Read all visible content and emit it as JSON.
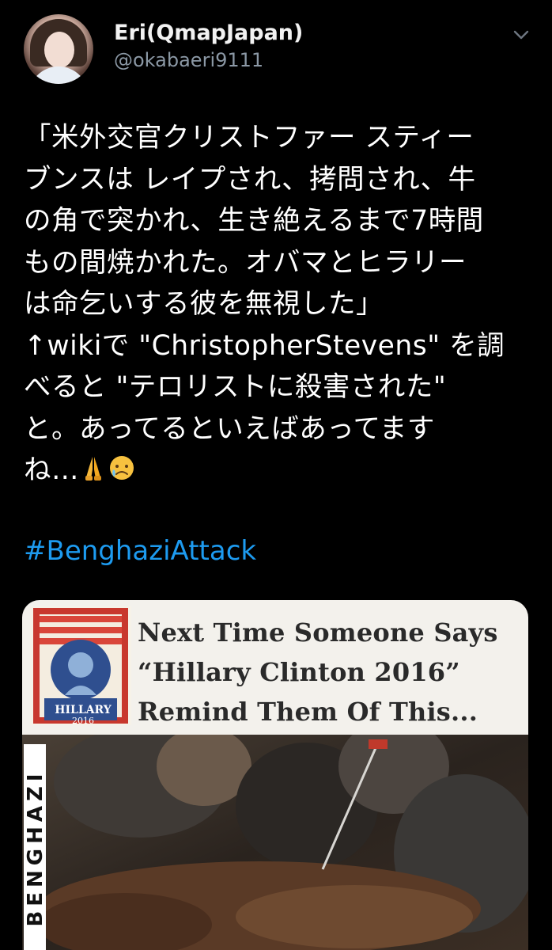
{
  "author": {
    "display_name": "Eri(QmapJapan)",
    "handle": "@okabaeri9111"
  },
  "tweet": {
    "lines": [
      "「米外交官クリストファー スティー",
      "ブンスは レイプされ、拷問され、牛",
      "の角で突かれ、生き絶えるまで7時間",
      "もの間焼かれた。オバマとヒラリー",
      "は命乞いする彼を無視した」",
      "↑wikiで \"ChristopherStevens\" を調",
      "べると \"テロリストに殺害された\"",
      "と。あってるといえばあってます",
      "ね…"
    ],
    "emojis": [
      "folded-hands",
      "sad-but-relieved-face"
    ],
    "hashtag": "#BenghaziAttack"
  },
  "media": {
    "poster_name": "HILLARY",
    "poster_year": "2016",
    "headline_lines": [
      "Next Time Someone Says",
      "“Hillary Clinton 2016”",
      "Remind Them Of This..."
    ],
    "side_word": "BENGHAZI"
  },
  "colors": {
    "background": "#000000",
    "text": "#ffffff",
    "muted": "#8b98a5",
    "link": "#1d9bf0"
  }
}
